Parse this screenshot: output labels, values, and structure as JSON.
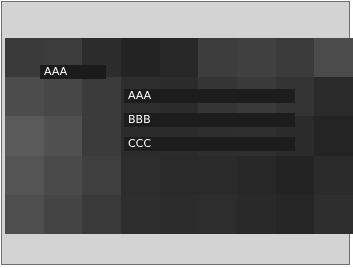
{
  "dropdown": {
    "selected_value": "AAA",
    "options": [
      {
        "label": "AAA"
      },
      {
        "label": "BBB"
      },
      {
        "label": "CCC"
      }
    ]
  },
  "colors": {
    "frame_background": "#d3d3d3",
    "frame_border": "#6e6e6e",
    "option_background": "#1d1d1d",
    "option_text": "#ffffff"
  },
  "background_tiles": [
    "#3a3a3a",
    "#3c3c3c",
    "#2c2c2c",
    "#232323",
    "#272727",
    "#3d3d3d",
    "#404040",
    "#3b3b3b",
    "#4b4b4b",
    "#4c4c4c",
    "#474747",
    "#3b3b3b",
    "#2d2d2d",
    "#2b2b2b",
    "#353535",
    "#3a3a3a",
    "#343434",
    "#2a2a2a",
    "#5a5a5a",
    "#505050",
    "#3b3b3b",
    "#2b2b2b",
    "#2b2b2b",
    "#2e2e2e",
    "#2f2f2f",
    "#2b2b2b",
    "#242424",
    "#545454",
    "#4a4a4a",
    "#3f3f3f",
    "#2d2d2d",
    "#2a2a2a",
    "#2a2a2a",
    "#272727",
    "#232323",
    "#2a2a2a",
    "#4e4e4e",
    "#444444",
    "#393939",
    "#2e2e2e",
    "#2c2c2c",
    "#2d2d2d",
    "#292929",
    "#262626",
    "#2e2e2e"
  ]
}
